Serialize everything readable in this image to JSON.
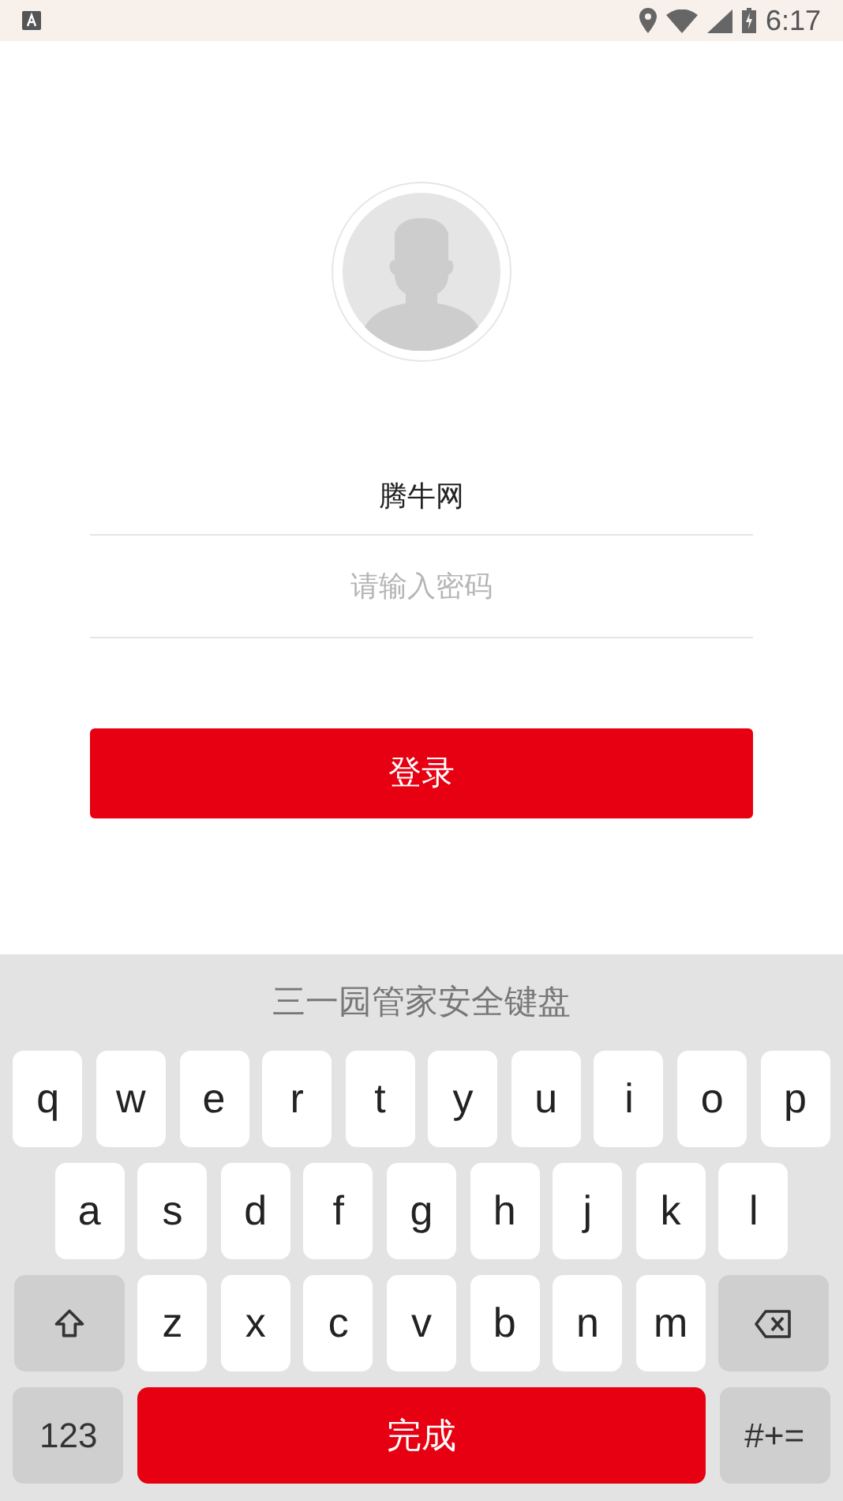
{
  "status_bar": {
    "time": "6:17"
  },
  "login": {
    "username": "腾牛网",
    "password": {
      "placeholder": "请输入密码"
    },
    "submit": "登录"
  },
  "keyboard": {
    "title": "三一园管家安全键盘",
    "rows": [
      [
        {
          "kind": "letter",
          "label": "q"
        },
        {
          "kind": "letter",
          "label": "w"
        },
        {
          "kind": "letter",
          "label": "e"
        },
        {
          "kind": "letter",
          "label": "r"
        },
        {
          "kind": "letter",
          "label": "t"
        },
        {
          "kind": "letter",
          "label": "y"
        },
        {
          "kind": "letter",
          "label": "u"
        },
        {
          "kind": "letter",
          "label": "i"
        },
        {
          "kind": "letter",
          "label": "o"
        },
        {
          "kind": "letter",
          "label": "p"
        }
      ],
      [
        {
          "kind": "letter",
          "label": "a"
        },
        {
          "kind": "letter",
          "label": "s"
        },
        {
          "kind": "letter",
          "label": "d"
        },
        {
          "kind": "letter",
          "label": "f"
        },
        {
          "kind": "letter",
          "label": "g"
        },
        {
          "kind": "letter",
          "label": "h"
        },
        {
          "kind": "letter",
          "label": "j"
        },
        {
          "kind": "letter",
          "label": "k"
        },
        {
          "kind": "letter",
          "label": "l"
        }
      ],
      [
        {
          "kind": "shift"
        },
        {
          "kind": "letter",
          "label": "z"
        },
        {
          "kind": "letter",
          "label": "x"
        },
        {
          "kind": "letter",
          "label": "c"
        },
        {
          "kind": "letter",
          "label": "v"
        },
        {
          "kind": "letter",
          "label": "b"
        },
        {
          "kind": "letter",
          "label": "n"
        },
        {
          "kind": "letter",
          "label": "m"
        },
        {
          "kind": "backspace"
        }
      ]
    ],
    "bottom_bar": [
      {
        "kind": "mode",
        "label": "123"
      },
      {
        "kind": "done",
        "label": "完成"
      },
      {
        "kind": "mode",
        "label": "#+="
      }
    ]
  }
}
